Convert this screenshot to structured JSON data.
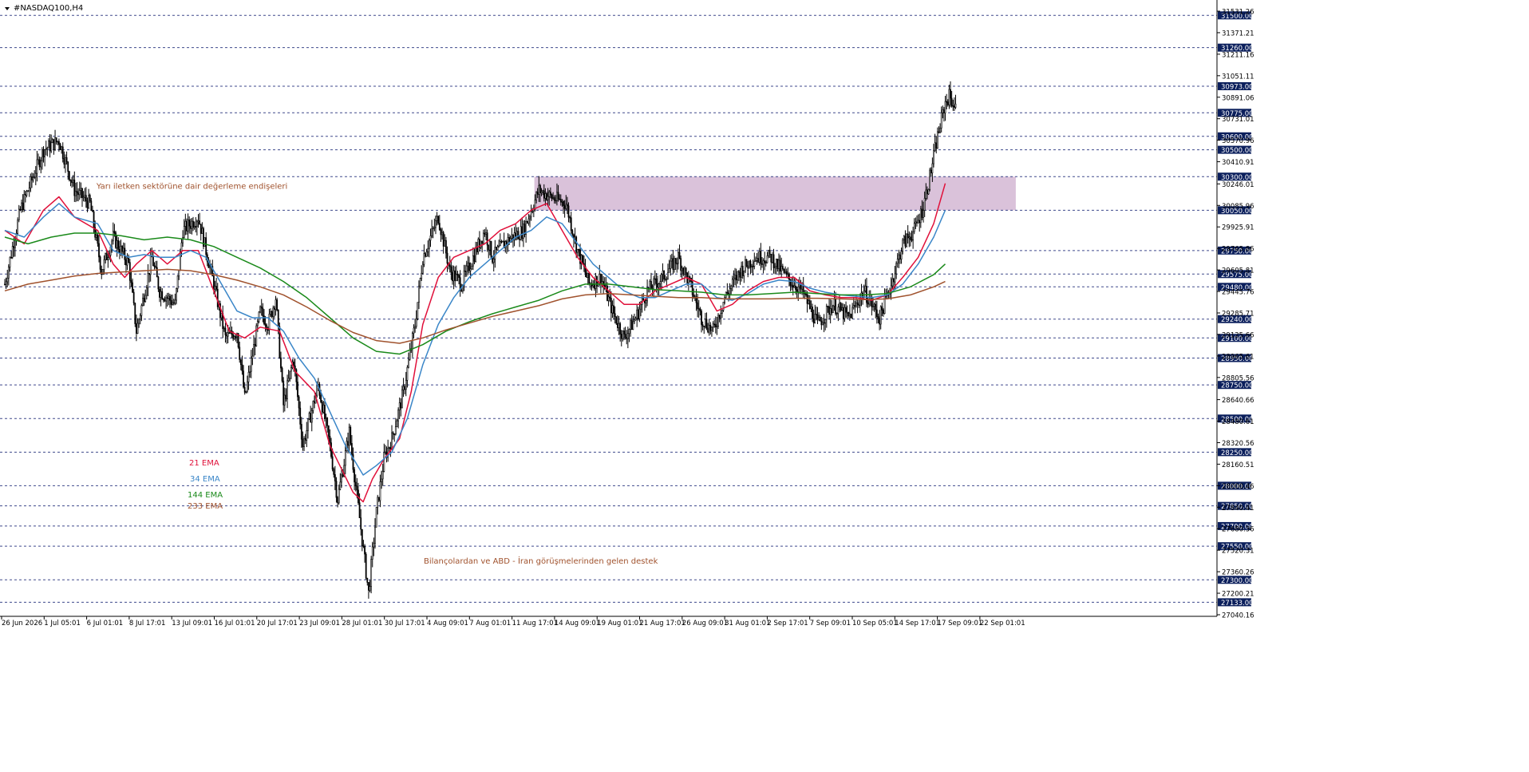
{
  "window": {
    "title": "#NASDAQ100,H4"
  },
  "colors": {
    "background": "#ffffff",
    "grid_line": "#1e2a78",
    "price_label_bg": "#0b1f5c",
    "price_label_text": "#ffffff",
    "candles": "#000000",
    "ema21": "#e0103a",
    "ema34": "#3a86c8",
    "ema144": "#1a8a1a",
    "ema233": "#a0522d",
    "zone_fill": "#d8bfd8",
    "annotation": "#a0522d"
  },
  "chart_data": {
    "type": "line",
    "title": "#NASDAQ100,H4",
    "xlabel": "",
    "ylabel": "",
    "ylim": [
      27040.16,
      31531.26
    ],
    "x_ticks": [
      "26 Jun 2026",
      "1 Jul 05:01",
      "6 Jul 01:01",
      "8 Jul 17:01",
      "13 Jul 09:01",
      "16 Jul 01:01",
      "20 Jul 17:01",
      "23 Jul 09:01",
      "28 Jul 01:01",
      "30 Jul 17:01",
      "4 Aug 09:01",
      "7 Aug 01:01",
      "11 Aug 17:01",
      "14 Aug 09:01",
      "19 Aug 01:01",
      "21 Aug 17:01",
      "26 Aug 09:01",
      "31 Aug 01:01",
      "2 Sep 17:01",
      "7 Sep 09:01",
      "10 Sep 05:01",
      "14 Sep 17:01",
      "17 Sep 09:01",
      "22 Sep 01:01"
    ],
    "y_ticks": [
      "31531.26",
      "31371.21",
      "31211.16",
      "31051.11",
      "30891.06",
      "30731.01",
      "30570.96",
      "30410.91",
      "30246.01",
      "30085.96",
      "29925.91",
      "29765.86",
      "29605.81",
      "29445.76",
      "29285.71",
      "29125.66",
      "28965.61",
      "28805.56",
      "28640.66",
      "28480.61",
      "28320.56",
      "28160.51",
      "28000.46",
      "27840.41",
      "27680.36",
      "27520.31",
      "27360.26",
      "27200.21",
      "27040.16"
    ],
    "horizontal_levels": [
      "31500.00",
      "31260.00",
      "30973.00",
      "30775.00",
      "30600.00",
      "30500.00",
      "30300.00",
      "30050.00",
      "29750.00",
      "29575.00",
      "29480.00",
      "29240.00",
      "29100.00",
      "28950.00",
      "28750.00",
      "28500.00",
      "28250.00",
      "28000.00",
      "27850.00",
      "27700.00",
      "27550.00",
      "27300.00",
      "27133.00"
    ],
    "zone": {
      "from_x": "11 Aug 17:01",
      "to_x": "22 Sep 01:01",
      "y_low": 30050,
      "y_high": 30300
    },
    "annotations": [
      {
        "text": "Yarı iletken sektörüne dair değerleme endişeleri",
        "x": "8 Jul 17:01",
        "y": 30210
      },
      {
        "text": "Bilançolardan ve ABD - İran görüşmelerinden gelen destek",
        "x": "4 Aug 09:01",
        "y": 27420
      }
    ],
    "legend": [
      {
        "text": "21 EMA",
        "series": "ema21"
      },
      {
        "text": "34 EMA",
        "series": "ema34"
      },
      {
        "text": "144 EMA",
        "series": "ema144"
      },
      {
        "text": "233 EMA",
        "series": "ema233"
      }
    ],
    "close_path": [
      [
        0,
        29500
      ],
      [
        2,
        30050
      ],
      [
        5,
        30500
      ],
      [
        7,
        30570
      ],
      [
        9,
        30200
      ],
      [
        11,
        30100
      ],
      [
        12.5,
        29600
      ],
      [
        14,
        29850
      ],
      [
        16,
        29650
      ],
      [
        17,
        29150
      ],
      [
        19,
        29700
      ],
      [
        20,
        29450
      ],
      [
        22,
        29350
      ],
      [
        23,
        29900
      ],
      [
        25,
        30000
      ],
      [
        27,
        29500
      ],
      [
        28.5,
        29100
      ],
      [
        30,
        29150
      ],
      [
        31,
        28650
      ],
      [
        33,
        29300
      ],
      [
        34,
        29200
      ],
      [
        35,
        29400
      ],
      [
        36,
        28600
      ],
      [
        37.3,
        28950
      ],
      [
        38.5,
        28300
      ],
      [
        40.5,
        28750
      ],
      [
        42,
        28300
      ],
      [
        43,
        27900
      ],
      [
        44.5,
        28400
      ],
      [
        47,
        27200
      ],
      [
        48,
        27800
      ],
      [
        49,
        28200
      ],
      [
        50,
        28350
      ],
      [
        51.5,
        28700
      ],
      [
        53,
        29200
      ],
      [
        54,
        29700
      ],
      [
        56,
        30000
      ],
      [
        57.5,
        29600
      ],
      [
        59,
        29500
      ],
      [
        60.5,
        29700
      ],
      [
        62,
        29900
      ],
      [
        63,
        29700
      ],
      [
        64.5,
        29800
      ],
      [
        65.5,
        29850
      ],
      [
        67,
        29900
      ],
      [
        69,
        30200
      ],
      [
        70.5,
        30150
      ],
      [
        72.5,
        30100
      ],
      [
        74,
        29750
      ],
      [
        75.5,
        29500
      ],
      [
        77,
        29550
      ],
      [
        78.5,
        29300
      ],
      [
        80,
        29100
      ],
      [
        81.5,
        29250
      ],
      [
        83,
        29450
      ],
      [
        85,
        29550
      ],
      [
        87,
        29700
      ],
      [
        88.5,
        29500
      ],
      [
        90,
        29250
      ],
      [
        91.5,
        29150
      ],
      [
        93,
        29400
      ],
      [
        95,
        29600
      ],
      [
        97,
        29700
      ],
      [
        99,
        29700
      ],
      [
        101,
        29550
      ],
      [
        103,
        29450
      ],
      [
        105,
        29200
      ],
      [
        107,
        29350
      ],
      [
        109,
        29250
      ],
      [
        111,
        29450
      ],
      [
        113,
        29250
      ],
      [
        114.5,
        29500
      ],
      [
        116,
        29800
      ],
      [
        117.5,
        29900
      ],
      [
        118.5,
        30050
      ],
      [
        119.5,
        30300
      ],
      [
        120.5,
        30600
      ],
      [
        121.5,
        30850
      ],
      [
        122,
        30900
      ],
      [
        123,
        30800
      ]
    ],
    "series": [
      {
        "name": "21 EMA",
        "key": "ema21",
        "values": [
          [
            0,
            29900
          ],
          [
            2.5,
            29800
          ],
          [
            5,
            30050
          ],
          [
            7,
            30150
          ],
          [
            9,
            30000
          ],
          [
            12,
            29900
          ],
          [
            14,
            29650
          ],
          [
            15.5,
            29550
          ],
          [
            17,
            29650
          ],
          [
            19,
            29750
          ],
          [
            21,
            29650
          ],
          [
            23,
            29750
          ],
          [
            25,
            29750
          ],
          [
            27,
            29450
          ],
          [
            29,
            29150
          ],
          [
            31,
            29100
          ],
          [
            33,
            29180
          ],
          [
            35.5,
            29150
          ],
          [
            37.5,
            28850
          ],
          [
            40,
            28700
          ],
          [
            42,
            28300
          ],
          [
            45,
            27950
          ],
          [
            46.3,
            27880
          ],
          [
            47.5,
            28050
          ],
          [
            49,
            28200
          ],
          [
            51,
            28350
          ],
          [
            52.5,
            28700
          ],
          [
            54,
            29200
          ],
          [
            56,
            29550
          ],
          [
            58,
            29700
          ],
          [
            60,
            29750
          ],
          [
            62,
            29800
          ],
          [
            64,
            29900
          ],
          [
            66,
            29950
          ],
          [
            68,
            30050
          ],
          [
            70,
            30100
          ],
          [
            72,
            29900
          ],
          [
            74,
            29700
          ],
          [
            76,
            29550
          ],
          [
            78,
            29450
          ],
          [
            80,
            29350
          ],
          [
            82,
            29350
          ],
          [
            84,
            29450
          ],
          [
            86,
            29500
          ],
          [
            88,
            29550
          ],
          [
            90,
            29500
          ],
          [
            92,
            29300
          ],
          [
            94,
            29350
          ],
          [
            96,
            29450
          ],
          [
            98,
            29520
          ],
          [
            100,
            29550
          ],
          [
            102,
            29550
          ],
          [
            104,
            29450
          ],
          [
            106,
            29420
          ],
          [
            108,
            29400
          ],
          [
            110,
            29400
          ],
          [
            112,
            29380
          ],
          [
            114,
            29420
          ],
          [
            116,
            29550
          ],
          [
            118,
            29700
          ],
          [
            120,
            29950
          ],
          [
            121.5,
            30250
          ]
        ]
      },
      {
        "name": "34 EMA",
        "key": "ema34",
        "values": [
          [
            0,
            29900
          ],
          [
            2.5,
            29850
          ],
          [
            5,
            30000
          ],
          [
            7,
            30100
          ],
          [
            9,
            30000
          ],
          [
            12,
            29950
          ],
          [
            14,
            29750
          ],
          [
            16,
            29700
          ],
          [
            18,
            29720
          ],
          [
            20,
            29700
          ],
          [
            22,
            29700
          ],
          [
            24,
            29750
          ],
          [
            26,
            29700
          ],
          [
            28,
            29500
          ],
          [
            30,
            29300
          ],
          [
            32,
            29250
          ],
          [
            34,
            29250
          ],
          [
            36,
            29150
          ],
          [
            38,
            28950
          ],
          [
            40,
            28800
          ],
          [
            42,
            28550
          ],
          [
            44,
            28300
          ],
          [
            46.3,
            28080
          ],
          [
            48,
            28150
          ],
          [
            50,
            28250
          ],
          [
            52,
            28500
          ],
          [
            54,
            28900
          ],
          [
            56,
            29200
          ],
          [
            58,
            29400
          ],
          [
            60,
            29550
          ],
          [
            62,
            29650
          ],
          [
            64,
            29750
          ],
          [
            66,
            29850
          ],
          [
            68,
            29900
          ],
          [
            70,
            30000
          ],
          [
            72,
            29950
          ],
          [
            74,
            29800
          ],
          [
            76,
            29650
          ],
          [
            78,
            29550
          ],
          [
            80,
            29450
          ],
          [
            82,
            29400
          ],
          [
            84,
            29400
          ],
          [
            86,
            29450
          ],
          [
            88,
            29500
          ],
          [
            90,
            29500
          ],
          [
            92,
            29400
          ],
          [
            94,
            29380
          ],
          [
            96,
            29430
          ],
          [
            98,
            29500
          ],
          [
            100,
            29530
          ],
          [
            102,
            29520
          ],
          [
            104,
            29470
          ],
          [
            106,
            29440
          ],
          [
            108,
            29420
          ],
          [
            110,
            29410
          ],
          [
            112,
            29400
          ],
          [
            114,
            29420
          ],
          [
            116,
            29500
          ],
          [
            118,
            29650
          ],
          [
            120,
            29850
          ],
          [
            121.5,
            30050
          ]
        ]
      },
      {
        "name": "144 EMA",
        "key": "ema144",
        "values": [
          [
            0,
            29850
          ],
          [
            3,
            29800
          ],
          [
            6,
            29850
          ],
          [
            9,
            29880
          ],
          [
            12,
            29880
          ],
          [
            15,
            29860
          ],
          [
            18,
            29830
          ],
          [
            21,
            29850
          ],
          [
            24,
            29830
          ],
          [
            27,
            29780
          ],
          [
            30,
            29700
          ],
          [
            33,
            29620
          ],
          [
            36,
            29520
          ],
          [
            39,
            29400
          ],
          [
            42,
            29250
          ],
          [
            45,
            29100
          ],
          [
            48,
            29000
          ],
          [
            51,
            28980
          ],
          [
            54,
            29050
          ],
          [
            57,
            29150
          ],
          [
            60,
            29220
          ],
          [
            63,
            29280
          ],
          [
            66,
            29330
          ],
          [
            69,
            29380
          ],
          [
            72,
            29450
          ],
          [
            75,
            29500
          ],
          [
            78,
            29500
          ],
          [
            81,
            29480
          ],
          [
            84,
            29460
          ],
          [
            87,
            29450
          ],
          [
            90,
            29440
          ],
          [
            93,
            29420
          ],
          [
            96,
            29420
          ],
          [
            99,
            29430
          ],
          [
            102,
            29440
          ],
          [
            105,
            29430
          ],
          [
            108,
            29420
          ],
          [
            111,
            29420
          ],
          [
            114,
            29430
          ],
          [
            117,
            29480
          ],
          [
            120,
            29570
          ],
          [
            121.5,
            29650
          ]
        ]
      },
      {
        "name": "233 EMA",
        "key": "ema233",
        "values": [
          [
            0,
            29450
          ],
          [
            3,
            29500
          ],
          [
            6,
            29530
          ],
          [
            9,
            29560
          ],
          [
            12,
            29580
          ],
          [
            15,
            29590
          ],
          [
            18,
            29600
          ],
          [
            21,
            29610
          ],
          [
            24,
            29600
          ],
          [
            27,
            29570
          ],
          [
            30,
            29530
          ],
          [
            33,
            29480
          ],
          [
            36,
            29420
          ],
          [
            39,
            29330
          ],
          [
            42,
            29230
          ],
          [
            45,
            29140
          ],
          [
            48,
            29080
          ],
          [
            51,
            29060
          ],
          [
            54,
            29100
          ],
          [
            57,
            29160
          ],
          [
            60,
            29210
          ],
          [
            63,
            29260
          ],
          [
            66,
            29300
          ],
          [
            69,
            29340
          ],
          [
            72,
            29390
          ],
          [
            75,
            29420
          ],
          [
            78,
            29430
          ],
          [
            81,
            29420
          ],
          [
            84,
            29410
          ],
          [
            87,
            29400
          ],
          [
            90,
            29400
          ],
          [
            93,
            29390
          ],
          [
            96,
            29390
          ],
          [
            99,
            29390
          ],
          [
            102,
            29395
          ],
          [
            105,
            29395
          ],
          [
            108,
            29390
          ],
          [
            111,
            29385
          ],
          [
            114,
            29390
          ],
          [
            117,
            29420
          ],
          [
            120,
            29480
          ],
          [
            121.5,
            29520
          ]
        ]
      }
    ]
  }
}
